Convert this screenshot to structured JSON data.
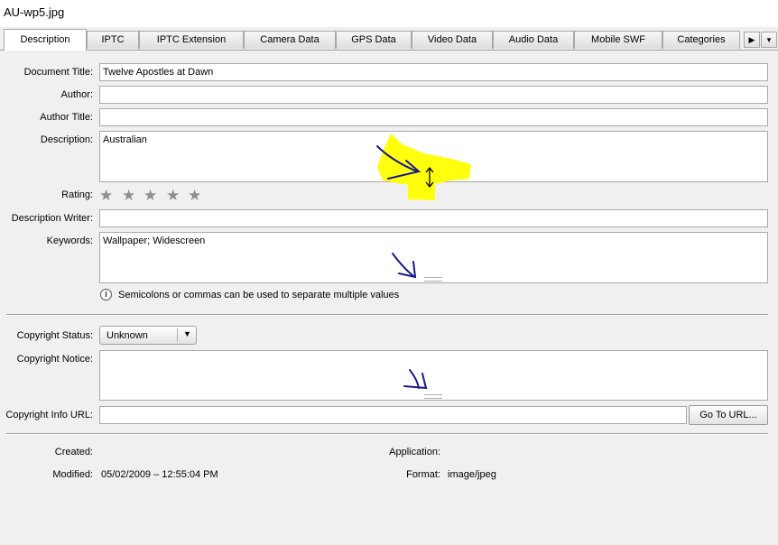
{
  "window": {
    "title": "AU-wp5.jpg"
  },
  "tabs": [
    {
      "label": "Description"
    },
    {
      "label": "IPTC"
    },
    {
      "label": "IPTC Extension"
    },
    {
      "label": "Camera Data"
    },
    {
      "label": "GPS Data"
    },
    {
      "label": "Video Data"
    },
    {
      "label": "Audio Data"
    },
    {
      "label": "Mobile SWF"
    },
    {
      "label": "Categories"
    }
  ],
  "tab_scroll": {
    "next_icon": "▶",
    "menu_icon": "▾"
  },
  "form": {
    "document_title_label": "Document Title:",
    "document_title_value": "Twelve Apostles at Dawn",
    "author_label": "Author:",
    "author_value": "",
    "author_title_label": "Author Title:",
    "author_title_value": "",
    "description_label": "Description:",
    "description_value": "Australian",
    "rating_label": "Rating:",
    "rating_value": 0,
    "rating_max": 5,
    "star_glyph": "★",
    "description_writer_label": "Description Writer:",
    "description_writer_value": "",
    "keywords_label": "Keywords:",
    "keywords_value": "Wallpaper; Widescreen",
    "keywords_hint": "Semicolons or commas can be used to separate multiple values",
    "info_icon_glyph": "i",
    "copyright_status_label": "Copyright Status:",
    "copyright_status_value": "Unknown",
    "dropdown_arrow": "▼",
    "copyright_notice_label": "Copyright Notice:",
    "copyright_notice_value": "",
    "copyright_url_label": "Copyright Info URL:",
    "copyright_url_value": "",
    "go_to_url_button": "Go To URL..."
  },
  "file_info": {
    "created_label": "Created:",
    "created_value": "",
    "modified_label": "Modified:",
    "modified_value": "05/02/2009 – 12:55:04 PM",
    "application_label": "Application:",
    "application_value": "",
    "format_label": "Format:",
    "format_value": "image/jpeg"
  },
  "colors": {
    "highlight": "#ffff00",
    "annotation_ink": "#1a1a8c",
    "panel_bg": "#f0f0f0"
  }
}
